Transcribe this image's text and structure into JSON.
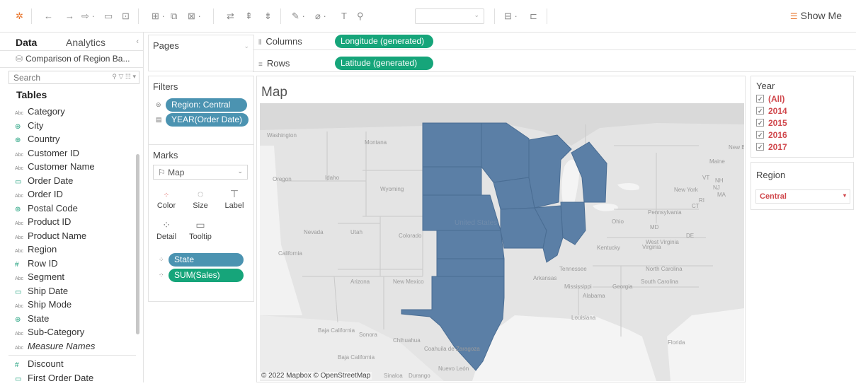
{
  "toolbar": {
    "icons": [
      "tableau-logo-icon",
      "back-icon",
      "forward-icon",
      "redo-icon",
      "save-icon",
      "new-datasource-icon",
      "new-worksheet-icon",
      "duplicate-icon",
      "clear-icon",
      "swap-icon",
      "sort-asc-icon",
      "sort-desc-icon",
      "highlight-icon",
      "group-icon",
      "label-icon",
      "pin-icon",
      "fit-dropdown",
      "presentation-icon",
      "tooltip-icon"
    ],
    "show_me": "Show Me"
  },
  "sidebar": {
    "tabs": [
      "Data",
      "Analytics"
    ],
    "datasource": "Comparison of Region Ba...",
    "search_placeholder": "Search",
    "tables_heading": "Tables",
    "fields": [
      {
        "name": "Category",
        "type": "Abc"
      },
      {
        "name": "City",
        "type": "geo"
      },
      {
        "name": "Country",
        "type": "geo"
      },
      {
        "name": "Customer ID",
        "type": "Abc"
      },
      {
        "name": "Customer Name",
        "type": "Abc"
      },
      {
        "name": "Order Date",
        "type": "date"
      },
      {
        "name": "Order ID",
        "type": "Abc"
      },
      {
        "name": "Postal Code",
        "type": "geo"
      },
      {
        "name": "Product ID",
        "type": "Abc"
      },
      {
        "name": "Product Name",
        "type": "Abc"
      },
      {
        "name": "Region",
        "type": "Abc"
      },
      {
        "name": "Row ID",
        "type": "#"
      },
      {
        "name": "Segment",
        "type": "Abc"
      },
      {
        "name": "Ship Date",
        "type": "date"
      },
      {
        "name": "Ship Mode",
        "type": "Abc"
      },
      {
        "name": "State",
        "type": "geo"
      },
      {
        "name": "Sub-Category",
        "type": "Abc"
      },
      {
        "name": "Measure Names",
        "type": "Abc",
        "italic": true
      }
    ],
    "measures": [
      {
        "name": "Discount",
        "type": "#"
      },
      {
        "name": "First Order Date",
        "type": "date"
      }
    ]
  },
  "shelves": {
    "pages_title": "Pages",
    "filters_title": "Filters",
    "filters": [
      "Region: Central",
      "YEAR(Order Date)"
    ],
    "marks_title": "Marks",
    "mark_type": "Map",
    "mark_buttons": [
      "Color",
      "Size",
      "Label",
      "Detail",
      "Tooltip"
    ],
    "mark_pills": [
      "State",
      "SUM(Sales)"
    ]
  },
  "columns": {
    "label": "Columns",
    "pill": "Longitude (generated)"
  },
  "rows": {
    "label": "Rows",
    "pill": "Latitude (generated)"
  },
  "viz": {
    "title": "Map",
    "copyright": "© 2022 Mapbox © OpenStreetMap",
    "highlight_color": "#5b7fa6",
    "place_labels": [
      "Washington",
      "Montana",
      "Oregon",
      "Idaho",
      "Wyoming",
      "Nevada",
      "Utah",
      "Colorado",
      "California",
      "Arizona",
      "New Mexico",
      "Baja California",
      "Sonora",
      "Chihuahua",
      "Coahuila de Zaragoza",
      "Nuevo León",
      "Baja California",
      "Sinaloa",
      "Durango",
      "Maine",
      "VT",
      "NH",
      "MA",
      "New York",
      "Pennsylvania",
      "Ohio",
      "MD",
      "DE",
      "West Virginia",
      "Virginia",
      "Kentucky",
      "Tennessee",
      "North Carolina",
      "South Carolina",
      "Georgia",
      "Alabama",
      "Mississippi",
      "Arkansas",
      "Louisiana",
      "Florida",
      "CT",
      "RI",
      "NJ",
      "New Brunsw",
      "United States"
    ]
  },
  "year_filter": {
    "title": "Year",
    "items": [
      "(All)",
      "2014",
      "2015",
      "2016",
      "2017"
    ]
  },
  "region_filter": {
    "title": "Region",
    "value": "Central"
  }
}
